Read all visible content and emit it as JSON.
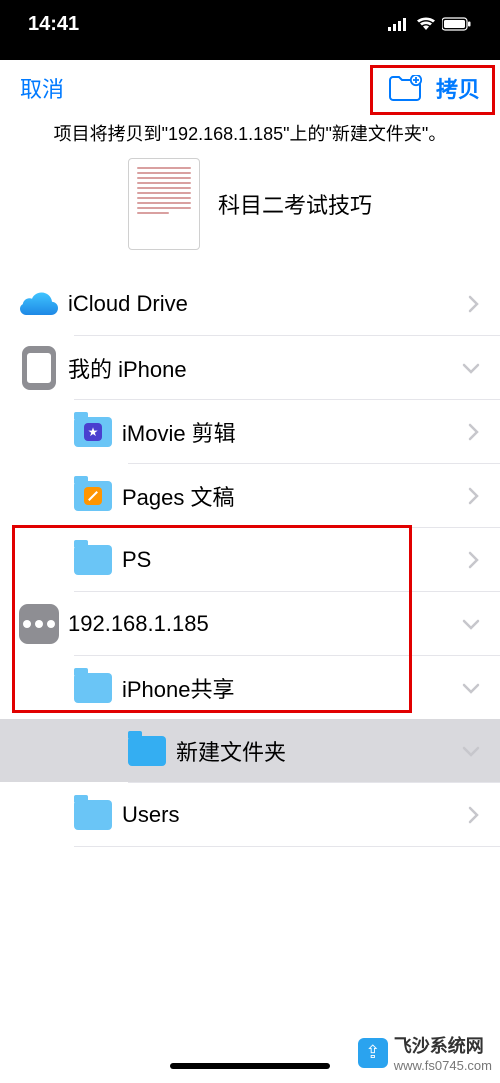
{
  "status": {
    "time": "14:41"
  },
  "nav": {
    "cancel": "取消",
    "copy": "拷贝"
  },
  "info_text": "项目将拷贝到\"192.168.1.185\"上的\"新建文件夹\"。",
  "document": {
    "title": "科目二考试技巧"
  },
  "locations": {
    "icloud": "iCloud Drive",
    "myiphone": "我的 iPhone",
    "imovie": "iMovie 剪辑",
    "pages": "Pages 文稿",
    "ps": "PS",
    "server": "192.168.1.185",
    "share": "iPhone共享",
    "newfolder": "新建文件夹",
    "users": "Users"
  },
  "watermark": {
    "brand": "飞沙系统网",
    "url": "www.fs0745.com"
  }
}
